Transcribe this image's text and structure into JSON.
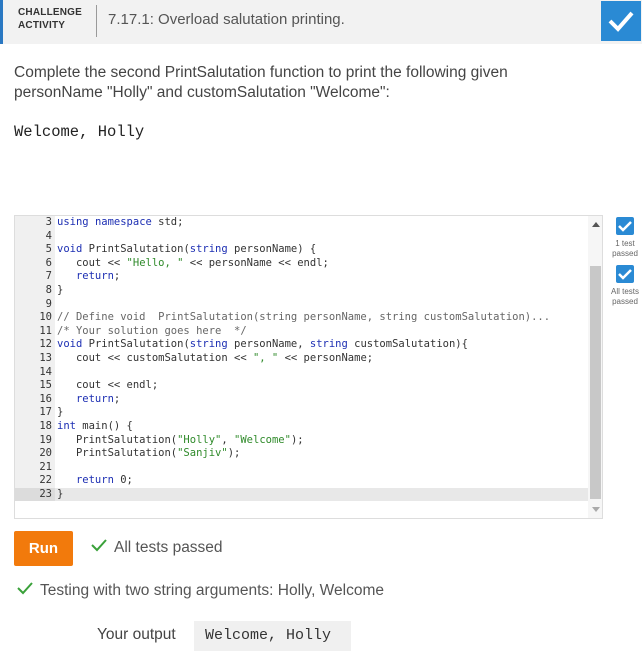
{
  "header": {
    "badge_line1": "CHALLENGE",
    "badge_line2": "ACTIVITY",
    "title": "7.17.1: Overload salutation printing.",
    "status_icon": "check-icon",
    "accent_color": "#2a8ad4"
  },
  "instructions": "Complete the second PrintSalutation function to print the following given personName \"Holly\" and customSalutation \"Welcome\":",
  "expected_output": "Welcome, Holly",
  "editor": {
    "lines": [
      {
        "n": "3",
        "html": "<span class=\"kw\">using</span> <span class=\"kw\">namespace</span> std;"
      },
      {
        "n": "4",
        "html": ""
      },
      {
        "n": "5",
        "html": "<span class=\"kw\">void</span> PrintSalutation(<span class=\"kw\">string</span> personName) {"
      },
      {
        "n": "6",
        "html": "   cout &lt;&lt; <span class=\"str\">\"Hello, \"</span> &lt;&lt; personName &lt;&lt; endl;"
      },
      {
        "n": "7",
        "html": "   <span class=\"kw\">return</span>;"
      },
      {
        "n": "8",
        "html": "}"
      },
      {
        "n": "9",
        "html": ""
      },
      {
        "n": "10",
        "html": "<span class=\"com\">// Define void  PrintSalutation(string personName, string customSalutation)...</span>"
      },
      {
        "n": "11",
        "html": "<span class=\"com\">/* Your solution goes here  */</span>"
      },
      {
        "n": "12",
        "html": "<span class=\"kw\">void</span> PrintSalutation(<span class=\"kw\">string</span> personName, <span class=\"kw\">string</span> customSalutation){"
      },
      {
        "n": "13",
        "html": "   cout &lt;&lt; customSalutation &lt;&lt; <span class=\"str\">\", \"</span> &lt;&lt; personName;"
      },
      {
        "n": "14",
        "html": ""
      },
      {
        "n": "15",
        "html": "   cout &lt;&lt; endl;"
      },
      {
        "n": "16",
        "html": "   <span class=\"kw\">return</span>;"
      },
      {
        "n": "17",
        "html": "}"
      },
      {
        "n": "18",
        "html": "<span class=\"kw\">int</span> main() {"
      },
      {
        "n": "19",
        "html": "   PrintSalutation(<span class=\"str\">\"Holly\"</span>, <span class=\"str\">\"Welcome\"</span>);"
      },
      {
        "n": "20",
        "html": "   PrintSalutation(<span class=\"str\">\"Sanjiv\"</span>);"
      },
      {
        "n": "21",
        "html": ""
      },
      {
        "n": "22",
        "html": "   <span class=\"kw\">return</span> 0;"
      },
      {
        "n": "23",
        "html": "}"
      }
    ],
    "active_line": "23"
  },
  "tests": [
    {
      "label": "1 test passed"
    },
    {
      "label": "All tests passed"
    }
  ],
  "run_label": "Run",
  "status_text": "All tests passed",
  "testing_text": "Testing with two string arguments: Holly, Welcome",
  "output_label": "Your output",
  "output_value": "Welcome, Holly",
  "success_color": "#3aa13a"
}
